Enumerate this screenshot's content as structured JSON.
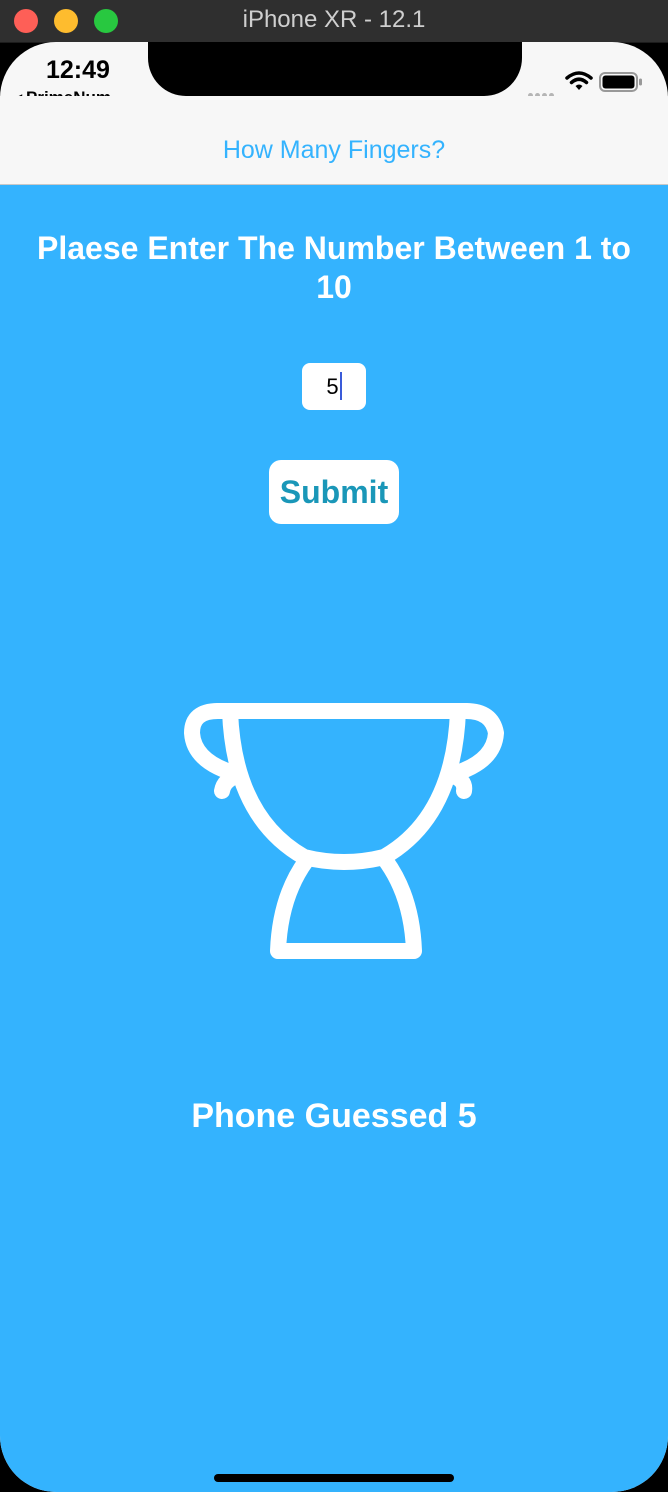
{
  "window": {
    "title": "iPhone XR - 12.1"
  },
  "status_bar": {
    "time": "12:49",
    "back_app": "PrimeNum..."
  },
  "nav": {
    "title": "How Many Fingers?"
  },
  "main": {
    "prompt": "Plaese Enter The Number Between 1 to 10",
    "input_value": "5",
    "submit_label": "Submit",
    "result": "Phone Guessed 5"
  },
  "colors": {
    "background": "#34b3fe",
    "nav_title": "#34b3fe",
    "button_text": "#1a97b8"
  },
  "icons": {
    "trophy": "trophy-icon",
    "wifi": "wifi-icon",
    "battery": "battery-icon",
    "back": "back-arrow-icon"
  }
}
